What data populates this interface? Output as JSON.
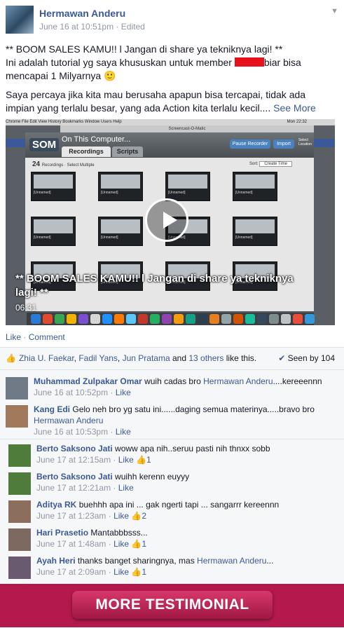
{
  "post": {
    "author": "Hermawan Anderu",
    "timestamp": "June 16 at 10:51pm",
    "edited": "Edited",
    "line1": "** BOOM SALES KAMU!! l Jangan di share ya tekniknya lagi! **",
    "line2a": "Ini adalah tutorial yg saya khususkan untuk member ",
    "line2b": "biar bisa mencapai 1 Milyarnya ",
    "emoji": "🙂",
    "para2": "Saya percaya jika kita mau berusaha apapun bisa tercapai, tidak ada impian yang terlalu besar, yang ada Action kita terlalu kecil....",
    "see_more": "See More",
    "menu_chevron": "chevron-down-icon"
  },
  "video": {
    "caption": "** BOOM SALES KAMU!! l Jangan di share ya tekniknya lagi! **",
    "duration": "06:31",
    "menubar": "Chrome  File  Edit  View  History  Bookmarks  Window  Users  Help",
    "clock": "Mon 22:32",
    "window_title": "Screencast-O-Matic",
    "app_logo": "SOM",
    "app_heading": "On This Computer...",
    "tab_recordings": "Recordings",
    "tab_scripts": "Scripts",
    "pause_recorder": "Pause Recorder",
    "import": "Import",
    "select_location": "Select Location",
    "count": "24",
    "count_label": "Recordings · Select Multiple",
    "sort_label": "Sort:",
    "sort_value": "Create Time",
    "thumb_label": "[Unnamed]"
  },
  "actions": {
    "like": "Like",
    "comment": "Comment"
  },
  "likes": {
    "names": [
      "Zhia U. Faekar",
      "Fadil Yans",
      "Jun Pratama"
    ],
    "others": "13 others",
    "suffix": "like this.",
    "seen": "Seen by 104"
  },
  "comments": [
    {
      "name": "Muhammad Zulpakar Omar",
      "text": "wuih cadas bro ",
      "mention": "Hermawan Anderu",
      "text2": "....kereeennn",
      "time": "June 16 at 10:52pm",
      "like": "Like",
      "count": ""
    },
    {
      "name": "Kang Edi",
      "text": "Gelo neh bro yg satu ini......daging semua materinya.....bravo bro ",
      "mention": "Hermawan Anderu",
      "text2": "",
      "time": "June 16 at 10:53pm",
      "like": "Like",
      "count": ""
    },
    {
      "name": "Berto Saksono Jati",
      "text": "woww apa nih..seruu pasti nih thnxx sobb",
      "mention": "",
      "text2": "",
      "time": "June 17 at 12:15am",
      "like": "Like",
      "count": "1"
    },
    {
      "name": "Berto Saksono Jati",
      "text": "wuihh kerenn euyyy",
      "mention": "",
      "text2": "",
      "time": "June 17 at 12:21am",
      "like": "Like",
      "count": ""
    },
    {
      "name": "Aditya RK",
      "text": "buehhh apa ini ... gak ngerti tapi ... sangarrr kereennn",
      "mention": "",
      "text2": "",
      "time": "June 17 at 1:23am",
      "like": "Like",
      "count": "2"
    },
    {
      "name": "Hari Prasetio",
      "text": "Mantabbbsss...",
      "mention": "",
      "text2": "",
      "time": "June 17 at 1:48am",
      "like": "Like",
      "count": "1"
    },
    {
      "name": "Ayah Heri",
      "text": "thanks banget sharingnya, mas ",
      "mention": "Hermawan Anderu",
      "text2": "...",
      "time": "June 17 at 2:09am",
      "like": "Like",
      "count": "1"
    }
  ],
  "cta": {
    "label": "MORE TESTIMONIAL"
  },
  "colors": {
    "brand": "#3b5998",
    "banner": "#b3194c",
    "redaction": "#e8101d"
  }
}
